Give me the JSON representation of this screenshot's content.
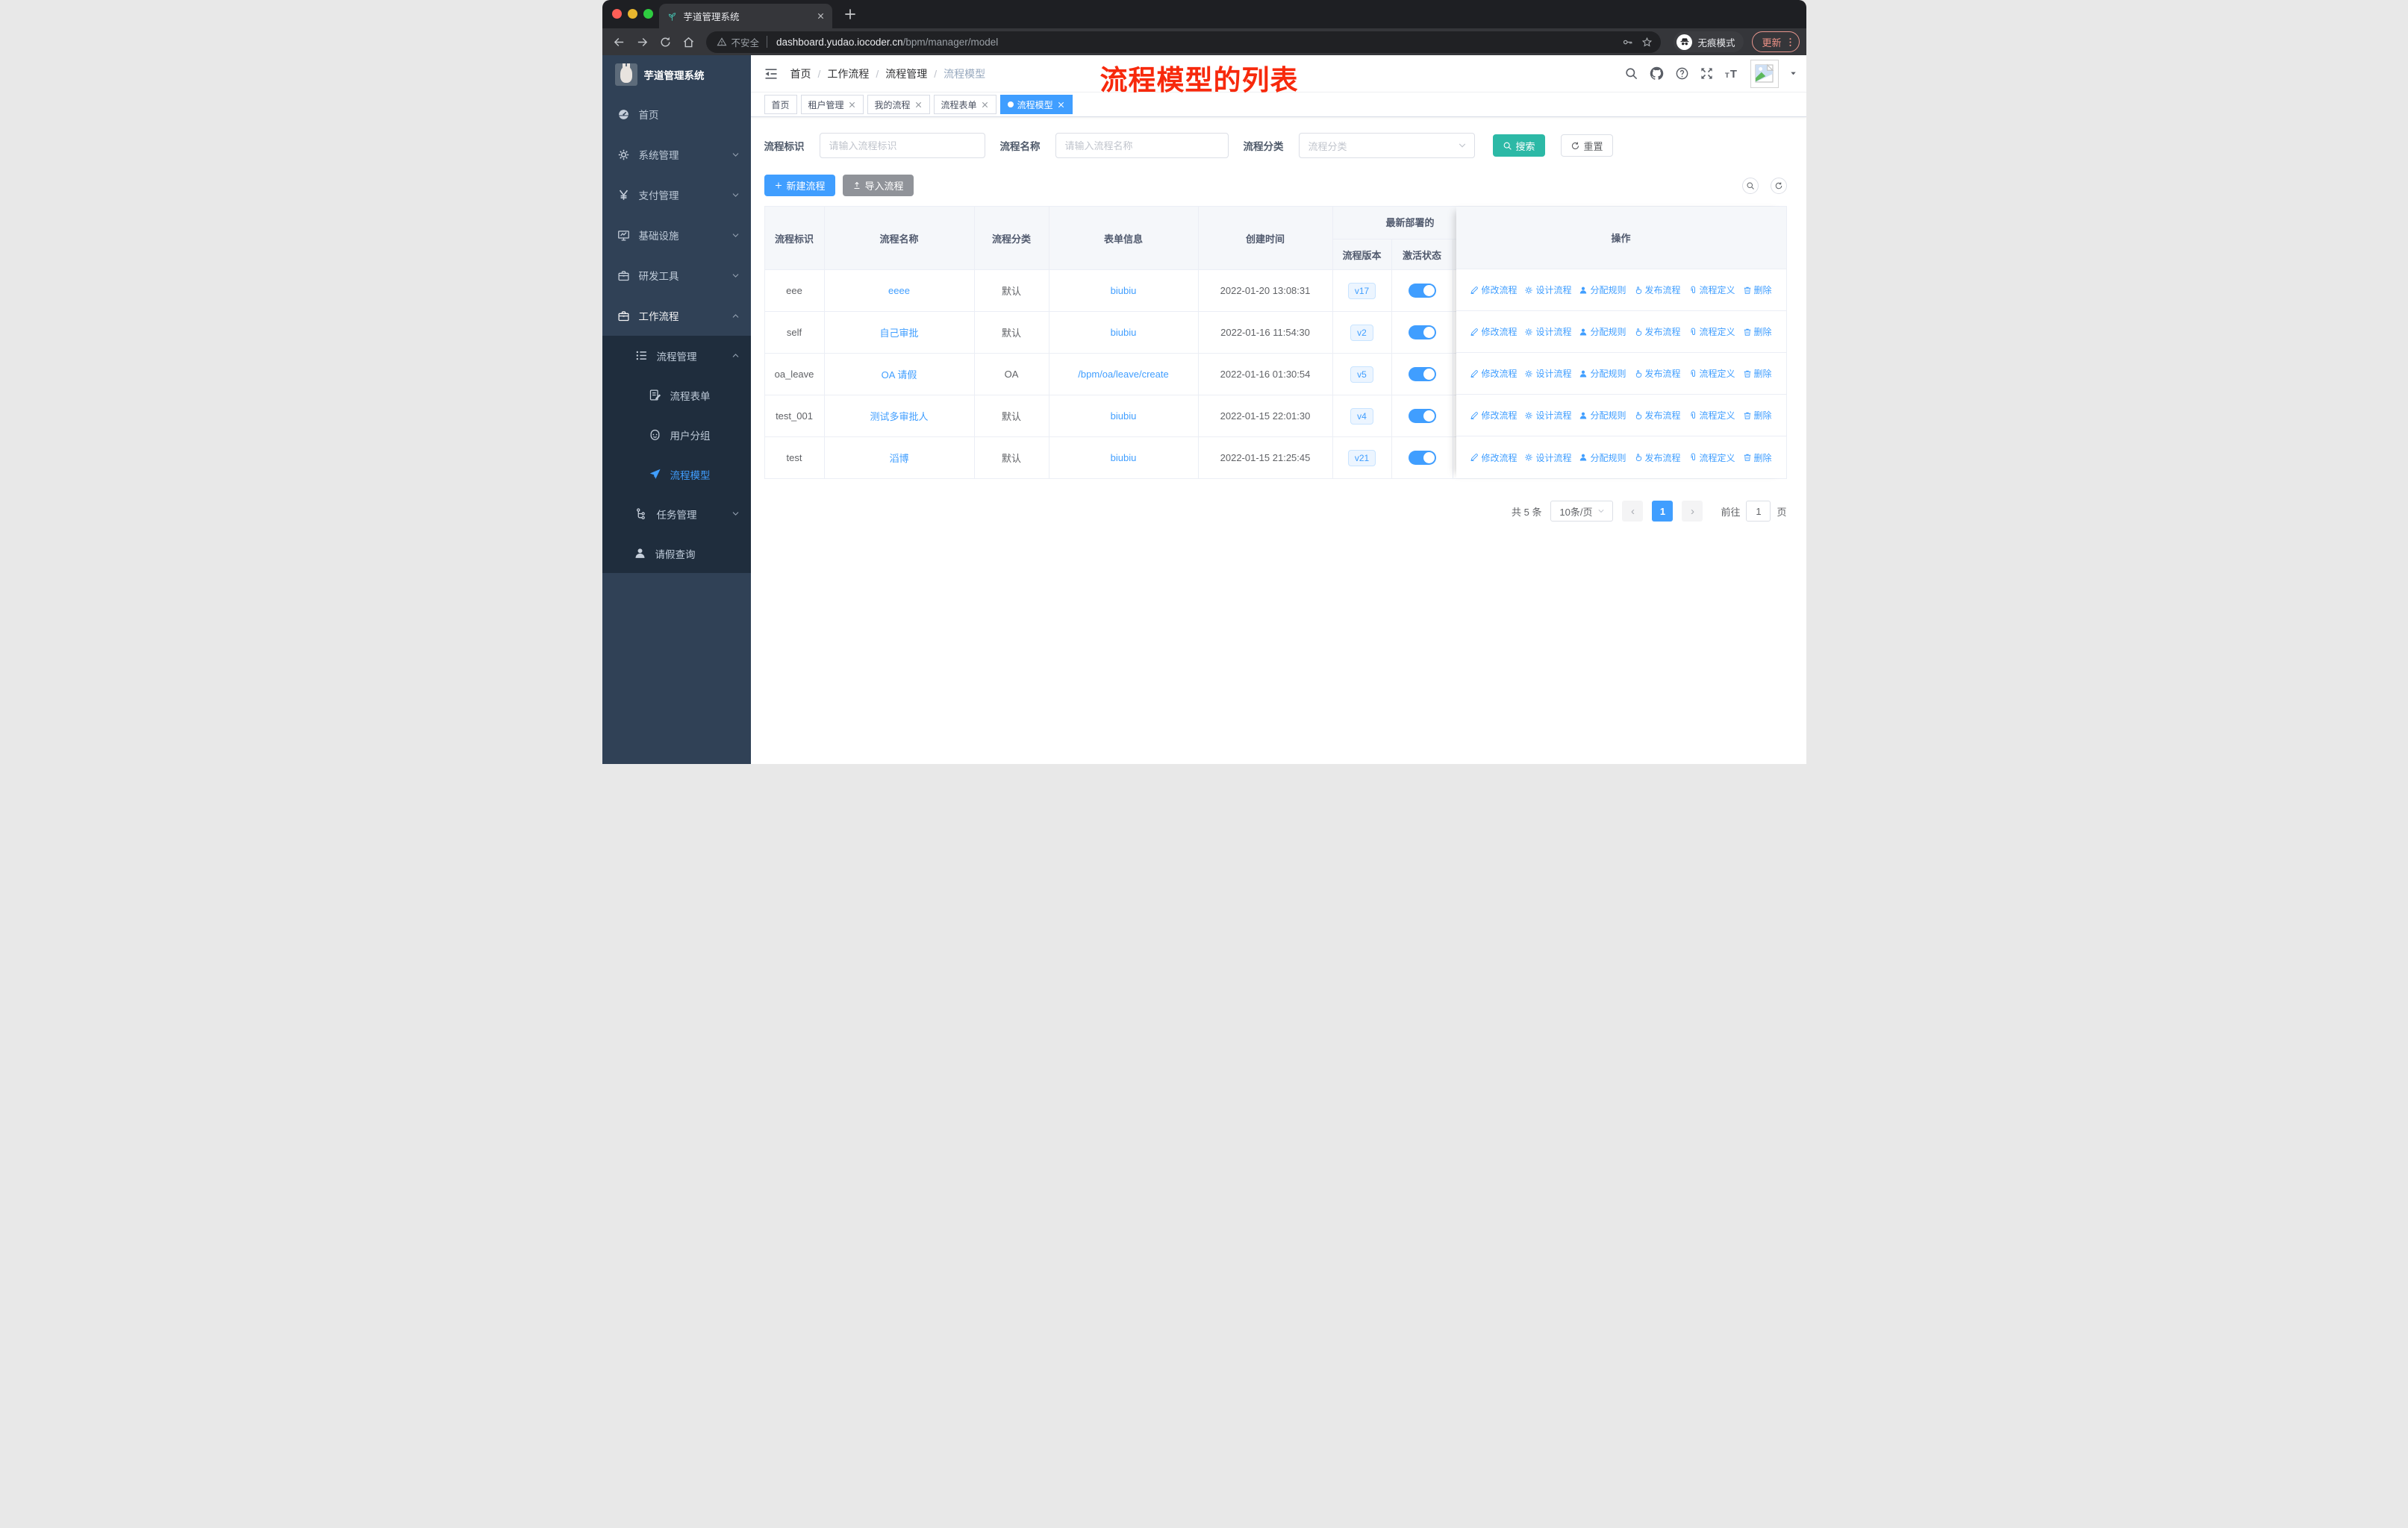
{
  "browser": {
    "tab_title": "芋道管理系统",
    "insecure_label": "不安全",
    "url_host": "dashboard.yudao.iocoder.cn",
    "url_path": "/bpm/manager/model",
    "incognito_label": "无痕模式",
    "update_label": "更新"
  },
  "sidebar": {
    "app_title": "芋道管理系统",
    "items": [
      {
        "label": "首页",
        "icon": "dashboard-icon",
        "indent": 20,
        "sub": false
      },
      {
        "label": "系统管理",
        "icon": "gear-icon",
        "indent": 20,
        "sub": false,
        "arrow": "down"
      },
      {
        "label": "支付管理",
        "icon": "yen-icon",
        "indent": 20,
        "sub": false,
        "arrow": "down"
      },
      {
        "label": "基础设施",
        "icon": "monitor-icon",
        "indent": 20,
        "sub": false,
        "arrow": "down"
      },
      {
        "label": "研发工具",
        "icon": "briefcase-icon",
        "indent": 20,
        "sub": false,
        "arrow": "down"
      },
      {
        "label": "工作流程",
        "icon": "briefcase-icon",
        "indent": 20,
        "sub": false,
        "arrow": "up",
        "trail": true
      },
      {
        "label": "流程管理",
        "icon": "list-icon",
        "indent": 44,
        "sub": true,
        "arrow": "up"
      },
      {
        "label": "流程表单",
        "icon": "form-icon",
        "indent": 62,
        "sub": true
      },
      {
        "label": "用户分组",
        "icon": "group-icon",
        "indent": 62,
        "sub": true
      },
      {
        "label": "流程模型",
        "icon": "plane-icon",
        "indent": 62,
        "sub": true,
        "active": true
      },
      {
        "label": "任务管理",
        "icon": "tasks-icon",
        "indent": 44,
        "sub": true,
        "arrow": "down"
      },
      {
        "label": "请假查询",
        "icon": "person-icon",
        "indent": 42,
        "sub": true
      }
    ]
  },
  "header": {
    "breadcrumb": [
      "首页",
      "工作流程",
      "流程管理",
      "流程模型"
    ],
    "annotation": "流程模型的列表"
  },
  "tags": [
    {
      "label": "首页",
      "closable": false,
      "active": false
    },
    {
      "label": "租户管理",
      "closable": true,
      "active": false
    },
    {
      "label": "我的流程",
      "closable": true,
      "active": false
    },
    {
      "label": "流程表单",
      "closable": true,
      "active": false
    },
    {
      "label": "流程模型",
      "closable": true,
      "active": true
    }
  ],
  "filters": {
    "id_label": "流程标识",
    "id_placeholder": "请输入流程标识",
    "name_label": "流程名称",
    "name_placeholder": "请输入流程名称",
    "category_label": "流程分类",
    "category_placeholder": "流程分类",
    "search_label": "搜索",
    "reset_label": "重置"
  },
  "toolbar": {
    "create_label": "新建流程",
    "import_label": "导入流程"
  },
  "table": {
    "columns": [
      "流程标识",
      "流程名称",
      "流程分类",
      "表单信息",
      "创建时间"
    ],
    "group_header": "最新部署的",
    "sub_columns": [
      "流程版本",
      "激活状态"
    ],
    "ops_header": "操作",
    "action_links": [
      {
        "label": "修改流程",
        "icon": "edit-icon"
      },
      {
        "label": "设计流程",
        "icon": "design-icon"
      },
      {
        "label": "分配规则",
        "icon": "assign-icon"
      },
      {
        "label": "发布流程",
        "icon": "publish-icon"
      },
      {
        "label": "流程定义",
        "icon": "definition-icon"
      },
      {
        "label": "删除",
        "icon": "delete-icon"
      }
    ],
    "rows": [
      {
        "id": "eee",
        "name": "eeee",
        "category": "默认",
        "form": "biubiu",
        "created": "2022-01-20 13:08:31",
        "version": "v17",
        "active": true
      },
      {
        "id": "self",
        "name": "自己审批",
        "category": "默认",
        "form": "biubiu",
        "created": "2022-01-16 11:54:30",
        "version": "v2",
        "active": true
      },
      {
        "id": "oa_leave",
        "name": "OA 请假",
        "category": "OA",
        "form": "/bpm/oa/leave/create",
        "created": "2022-01-16 01:30:54",
        "version": "v5",
        "active": true
      },
      {
        "id": "test_001",
        "name": "测试多审批人",
        "category": "默认",
        "form": "biubiu",
        "created": "2022-01-15 22:01:30",
        "version": "v4",
        "active": true
      },
      {
        "id": "test",
        "name": "滔博",
        "category": "默认",
        "form": "biubiu",
        "created": "2022-01-15 21:25:45",
        "version": "v21",
        "active": true
      }
    ]
  },
  "pagination": {
    "total": "共 5 条",
    "page_size": "10条/页",
    "prev": "‹",
    "page": "1",
    "next": "›",
    "goto_label": "前往",
    "goto_value": "1",
    "unit_label": "页"
  },
  "colors": {
    "accent": "#409eff",
    "search_teal": "#2cb9a6",
    "annotation_red": "#f7290c",
    "sidebar": "#304156"
  }
}
